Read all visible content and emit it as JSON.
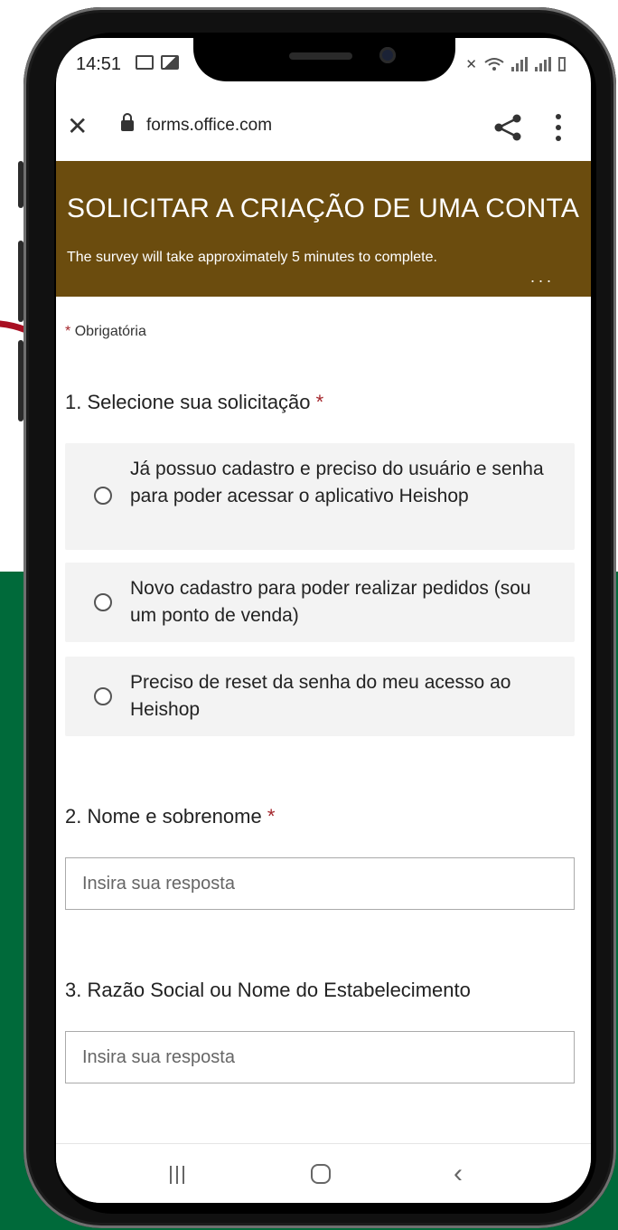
{
  "status_bar": {
    "time": "14:51"
  },
  "browser": {
    "url": "forms.office.com",
    "close_icon": "close-icon",
    "share_icon": "share-icon",
    "more_icon": "more-vert-icon"
  },
  "form": {
    "title": "SOLICITAR A CRIAÇÃO DE UMA CONTA",
    "subtitle": "The survey will take approximately 5 minutes to complete.",
    "header_color": "#6b4c0e",
    "required_marker": "*",
    "required_note": "Obrigatória",
    "more_label": "..."
  },
  "questions": [
    {
      "number": "1.",
      "text": "Selecione sua solicitação",
      "required": "*",
      "options": [
        "Já possuo cadastro e preciso do usuário e senha para poder acessar o aplicativo Heishop",
        "Novo cadastro para poder realizar pedidos (sou um ponto de venda)",
        "Preciso de reset da senha do meu acesso ao Heishop"
      ]
    },
    {
      "number": "2.",
      "text": "Nome e sobrenome",
      "required": "*",
      "placeholder": "Insira sua resposta"
    },
    {
      "number": "3.",
      "text": "Razão Social ou Nome do Estabelecimento",
      "placeholder": "Insira sua resposta"
    }
  ],
  "colors": {
    "background_green": "#006a3a",
    "accent_red": "#a4262c"
  }
}
